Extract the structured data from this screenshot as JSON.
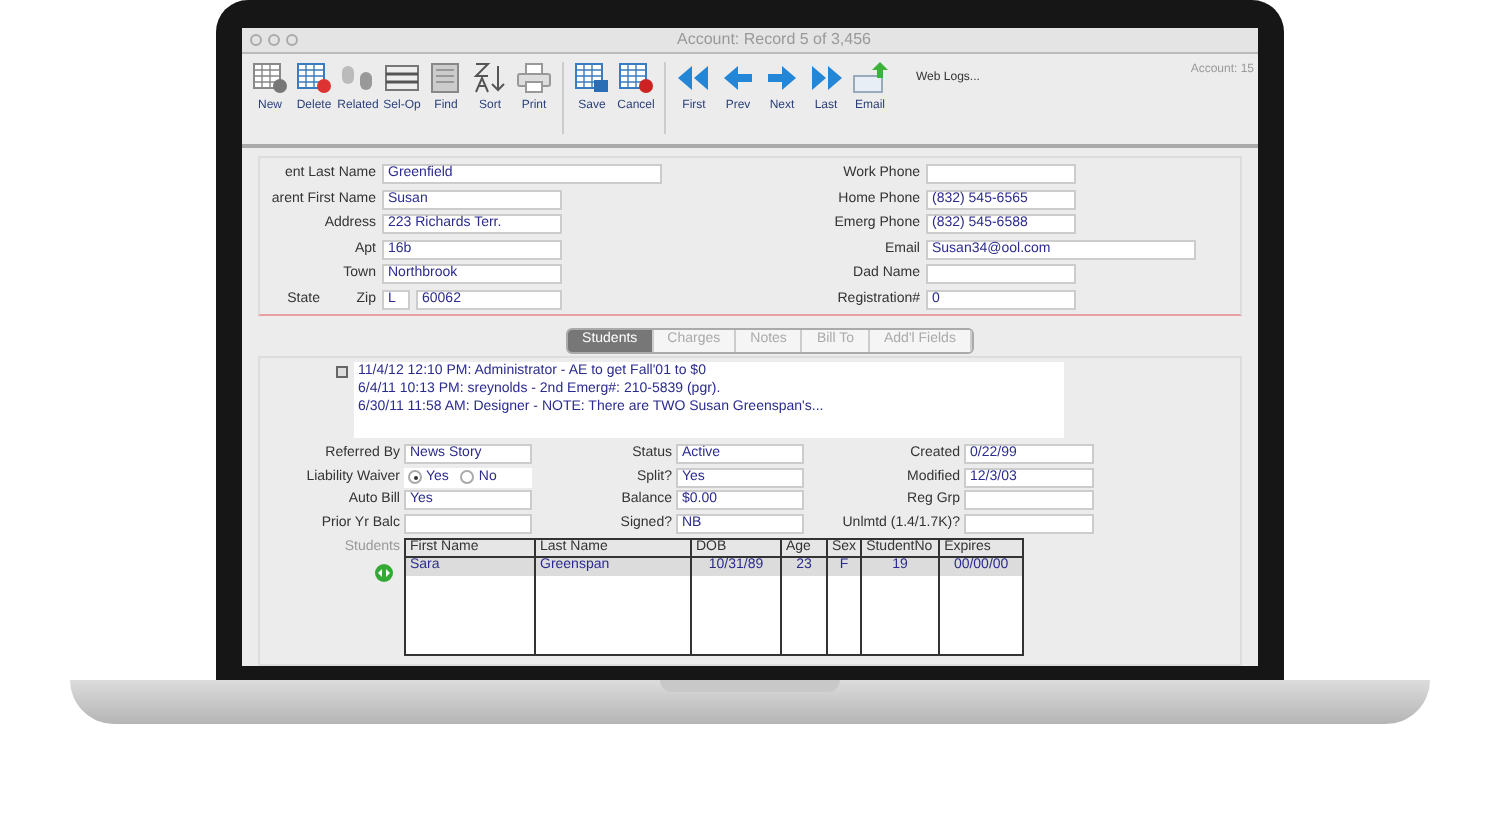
{
  "window": {
    "title": "Account: Record 5 of 3,456",
    "account_label": "Account: 15"
  },
  "toolbar": [
    {
      "kind": "new",
      "label": "New",
      "separator_before": false
    },
    {
      "kind": "delete",
      "label": "Delete",
      "separator_before": false
    },
    {
      "kind": "related",
      "label": "Related",
      "separator_before": false
    },
    {
      "kind": "selop",
      "label": "Sel-Op",
      "separator_before": false
    },
    {
      "kind": "find",
      "label": "Find",
      "separator_before": false
    },
    {
      "kind": "sort",
      "label": "Sort",
      "separator_before": false
    },
    {
      "kind": "print",
      "label": "Print",
      "separator_before": false
    },
    {
      "kind": "save",
      "label": "Save",
      "separator_before": true
    },
    {
      "kind": "cancel",
      "label": "Cancel",
      "separator_before": false
    },
    {
      "kind": "first",
      "label": "First",
      "separator_before": true
    },
    {
      "kind": "prev",
      "label": "Prev",
      "separator_before": false
    },
    {
      "kind": "next",
      "label": "Next",
      "separator_before": false
    },
    {
      "kind": "last",
      "label": "Last",
      "separator_before": false
    },
    {
      "kind": "email",
      "label": "Email",
      "separator_before": false
    }
  ],
  "web_logs": "Web Logs...",
  "left_fields": [
    {
      "label": "ent Last Name",
      "value": "Greenfield"
    },
    {
      "label": "arent First Name",
      "value": "Susan"
    },
    {
      "label": "Address",
      "value": "223 Richards Terr."
    },
    {
      "label": "Apt",
      "value": "16b"
    },
    {
      "label": "Town",
      "value": "Northbrook"
    }
  ],
  "state_row": {
    "label": "State",
    "zip_label": "Zip",
    "state": "L",
    "zip": "60062"
  },
  "right_fields": [
    {
      "label": "Work Phone"
    },
    {
      "label": "Home Phone",
      "value": "(832) 545-6565"
    },
    {
      "label": "Emerg Phone",
      "value": "(832) 545-6588"
    },
    {
      "label": "Email",
      "value": "Susan34@ool.com"
    },
    {
      "label": "Dad Name"
    },
    {
      "label": "Registration#",
      "value": "0"
    }
  ],
  "tabs": [
    {
      "label": "Students",
      "selected": true
    },
    {
      "label": "Charges",
      "selected": false
    },
    {
      "label": "Notes",
      "selected": false
    },
    {
      "label": "Bill To",
      "selected": false
    },
    {
      "label": "Add'l Fields",
      "selected": false
    }
  ],
  "notes": [
    "11/4/12 12:10 PM:  Administrator - AE to get Fall'01 to $0",
    "6/4/11 10:13 PM:  sreynolds - 2nd Emerg#: 210-5839 (pgr).",
    "6/30/11 11:58 AM:  Designer - NOTE:  There are TWO Susan Greenspan's..."
  ],
  "details": [
    [
      {
        "kind": "text",
        "label": "Referred By",
        "value": "News Story"
      },
      {
        "kind": "radio",
        "label": "Liability Waiver",
        "options": [
          {
            "label": "Yes",
            "selected": true
          },
          {
            "label": "No",
            "selected": false
          }
        ]
      },
      {
        "kind": "text",
        "label": "Auto Bill",
        "value": "Yes"
      },
      {
        "kind": "text",
        "label": "Prior Yr Balc"
      }
    ],
    [
      {
        "kind": "text",
        "label": "Status",
        "value": "Active"
      },
      {
        "kind": "text",
        "label": "Split?",
        "value": "Yes"
      },
      {
        "kind": "text",
        "label": "Balance",
        "value": "$0.00"
      },
      {
        "kind": "text",
        "label": "Signed?",
        "value": "NB"
      }
    ],
    [
      {
        "kind": "text",
        "label": "Created",
        "value": "0/22/99"
      },
      {
        "kind": "text",
        "label": "Modified",
        "value": "12/3/03"
      },
      {
        "kind": "text",
        "label": "Reg Grp"
      },
      {
        "kind": "text",
        "label": "Unlmtd (1.4/1.7K)?"
      }
    ]
  ],
  "students": {
    "label": "Students",
    "columns": [
      "First Name",
      "Last Name",
      "DOB",
      "Age",
      "Sex",
      "StudentNo",
      "Expires"
    ],
    "rows": [
      [
        "Sara",
        "Greenspan",
        "10/31/89",
        "23",
        "F",
        "19",
        "00/00/00"
      ]
    ]
  }
}
